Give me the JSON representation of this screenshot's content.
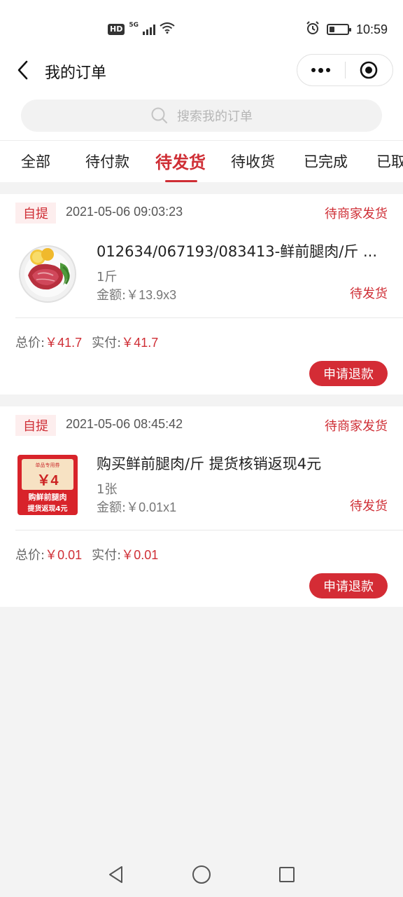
{
  "status_bar": {
    "hd": "HD",
    "network": "5G",
    "time": "10:59",
    "battery_level": 0.3
  },
  "nav": {
    "title": "我的订单"
  },
  "search": {
    "placeholder": "搜索我的订单"
  },
  "tabs": [
    {
      "label": "全部",
      "active": false
    },
    {
      "label": "待付款",
      "active": false
    },
    {
      "label": "待发货",
      "active": true
    },
    {
      "label": "待收货",
      "active": false
    },
    {
      "label": "已完成",
      "active": false
    },
    {
      "label": "已取消",
      "active": false
    }
  ],
  "orders": [
    {
      "tag": "自提",
      "time": "2021-05-06 09:03:23",
      "status": "待商家发货",
      "item": {
        "title": "012634/067193/083413-鲜前腿肉/斤 ...",
        "spec": "1斤",
        "amount_label": "金额:",
        "amount": "￥13.9x3",
        "status": "待发货",
        "thumb_icon": "meat-icon"
      },
      "total_label": "总价:",
      "total": "￥41.7",
      "paid_label": "实付:",
      "paid": "￥41.7",
      "refund_label": "申请退款"
    },
    {
      "tag": "自提",
      "time": "2021-05-06 08:45:42",
      "status": "待商家发货",
      "item": {
        "title": "购买鲜前腿肉/斤 提货核销返现4元",
        "spec": "1张",
        "amount_label": "金额:",
        "amount": "￥0.01x1",
        "status": "待发货",
        "thumb_icon": "coupon-icon",
        "coupon": {
          "top_label": "单品专用券",
          "value": "￥4",
          "line1": "购鲜前腿肉",
          "line2": "提货返现4元"
        }
      },
      "total_label": "总价:",
      "total": "￥0.01",
      "paid_label": "实付:",
      "paid": "￥0.01",
      "refund_label": "申请退款"
    }
  ],
  "colors": {
    "accent": "#cf2e35",
    "button": "#d42c35",
    "tag_bg": "#fdeeee",
    "page_bg": "#f3f3f3"
  }
}
